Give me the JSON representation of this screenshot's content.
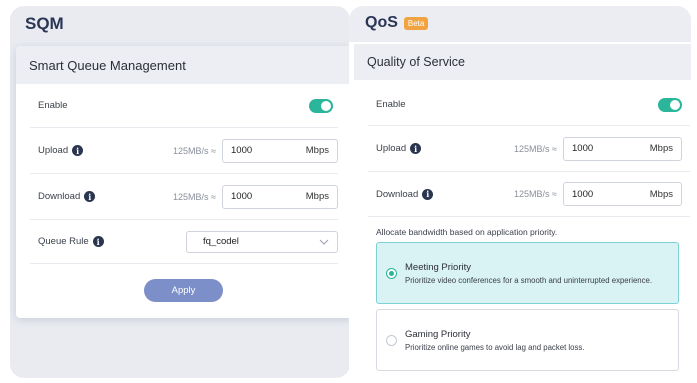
{
  "sqm": {
    "title": "SQM",
    "card_title": "Smart Queue Management",
    "enable_label": "Enable",
    "upload": {
      "label": "Upload",
      "hint": "125MB/s ≈",
      "value": "1000",
      "unit": "Mbps"
    },
    "download": {
      "label": "Download",
      "hint": "125MB/s ≈",
      "value": "1000",
      "unit": "Mbps"
    },
    "queue_rule": {
      "label": "Queue Rule",
      "value": "fq_codel"
    },
    "apply_label": "Apply"
  },
  "qos": {
    "title": "QoS",
    "badge": "Beta",
    "card_title": "Quality of Service",
    "enable_label": "Enable",
    "upload": {
      "label": "Upload",
      "hint": "125MB/s ≈",
      "value": "1000",
      "unit": "Mbps"
    },
    "download": {
      "label": "Download",
      "hint": "125MB/s ≈",
      "value": "1000",
      "unit": "Mbps"
    },
    "allocate_text": "Allocate bandwidth based on application priority.",
    "priorities": [
      {
        "title": "Meeting Priority",
        "desc": "Prioritize video conferences for a smooth and uninterrupted experience.",
        "selected": true
      },
      {
        "title": "Gaming Priority",
        "desc": "Prioritize online games to avoid lag and packet loss.",
        "selected": false
      }
    ]
  },
  "icons": {
    "info": "info-icon",
    "toggle": "toggle-switch",
    "chevron": "chevron-down-icon"
  },
  "colors": {
    "accent": "#2bb59a",
    "apply": "#7c8fc9",
    "beta": "#f0a340",
    "selected_bg": "#d9f2f4"
  }
}
